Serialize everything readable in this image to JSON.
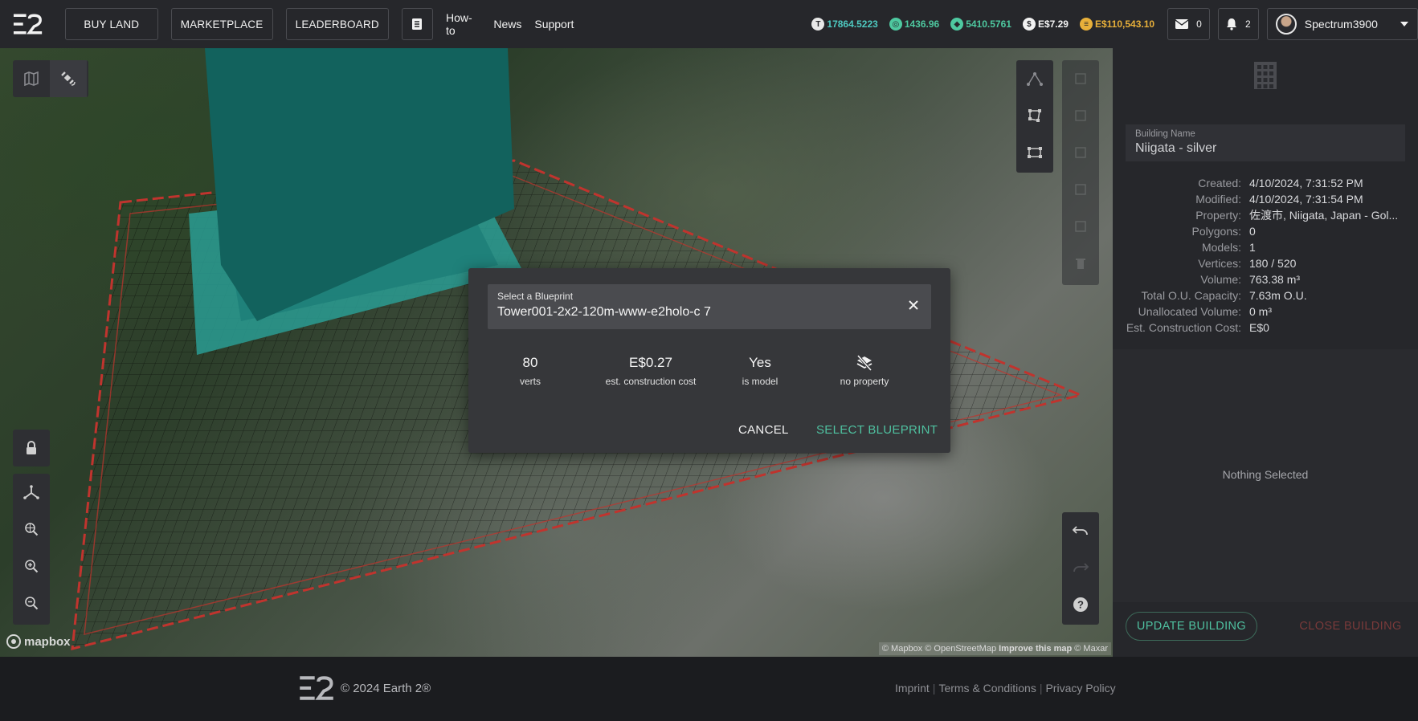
{
  "header": {
    "nav_buttons": [
      "BUY LAND",
      "MARKETPLACE",
      "LEADERBOARD"
    ],
    "links": [
      "How-to",
      "News",
      "Support"
    ],
    "balances": [
      {
        "icon": "tile-icon",
        "value": "17864.5223",
        "color": "#4ec9c0"
      },
      {
        "icon": "ether-icon",
        "value": "1436.96",
        "color": "#4ec9a0"
      },
      {
        "icon": "gem-icon",
        "value": "5410.5761",
        "color": "#4ec9a0"
      },
      {
        "icon": "dollar-icon",
        "value": "E$7.29",
        "color": "#f2f2f2"
      },
      {
        "icon": "coin-icon",
        "value": "E$110,543.10",
        "color": "#e8b03a"
      }
    ],
    "mail_count": "0",
    "notif_count": "2",
    "username": "Spectrum3900"
  },
  "map": {
    "mapbox_label": "mapbox",
    "attribution_1": "© Mapbox © OpenStreetMap",
    "attribution_improve": "Improve this map",
    "attribution_2": "© Maxar"
  },
  "modal": {
    "select_label": "Select a Blueprint",
    "select_value": "Tower001-2x2-120m-www-e2holo-c 7",
    "stats": [
      {
        "value": "80",
        "caption": "verts"
      },
      {
        "value": "E$0.27",
        "caption": "est. construction cost"
      },
      {
        "value": "Yes",
        "caption": "is model"
      },
      {
        "value": "",
        "caption": "no property"
      }
    ],
    "cancel_label": "CANCEL",
    "select_label_btn": "SELECT BLUEPRINT"
  },
  "panel": {
    "building_name_label": "Building Name",
    "building_name": "Niigata - silver",
    "info": [
      {
        "k": "Created:",
        "v": "4/10/2024, 7:31:52 PM"
      },
      {
        "k": "Modified:",
        "v": "4/10/2024, 7:31:54 PM"
      },
      {
        "k": "Property:",
        "v": "佐渡市, Niigata, Japan - Gol..."
      },
      {
        "k": "Polygons:",
        "v": "0"
      },
      {
        "k": "Models:",
        "v": "1"
      },
      {
        "k": "Vertices:",
        "v": "180 / 520"
      },
      {
        "k": "Volume:",
        "v": "763.38 m³"
      },
      {
        "k": "Total O.U. Capacity:",
        "v": "7.63m O.U."
      },
      {
        "k": "Unallocated Volume:",
        "v": "0 m³"
      },
      {
        "k": "Est. Construction Cost:",
        "v": "E$0"
      }
    ],
    "nothing_selected": "Nothing Selected",
    "update_label": "UPDATE BUILDING",
    "close_label": "CLOSE BUILDING"
  },
  "footer": {
    "copyright": "© 2024 Earth 2®",
    "links": [
      "Imprint",
      "Terms & Conditions",
      "Privacy Policy"
    ]
  }
}
